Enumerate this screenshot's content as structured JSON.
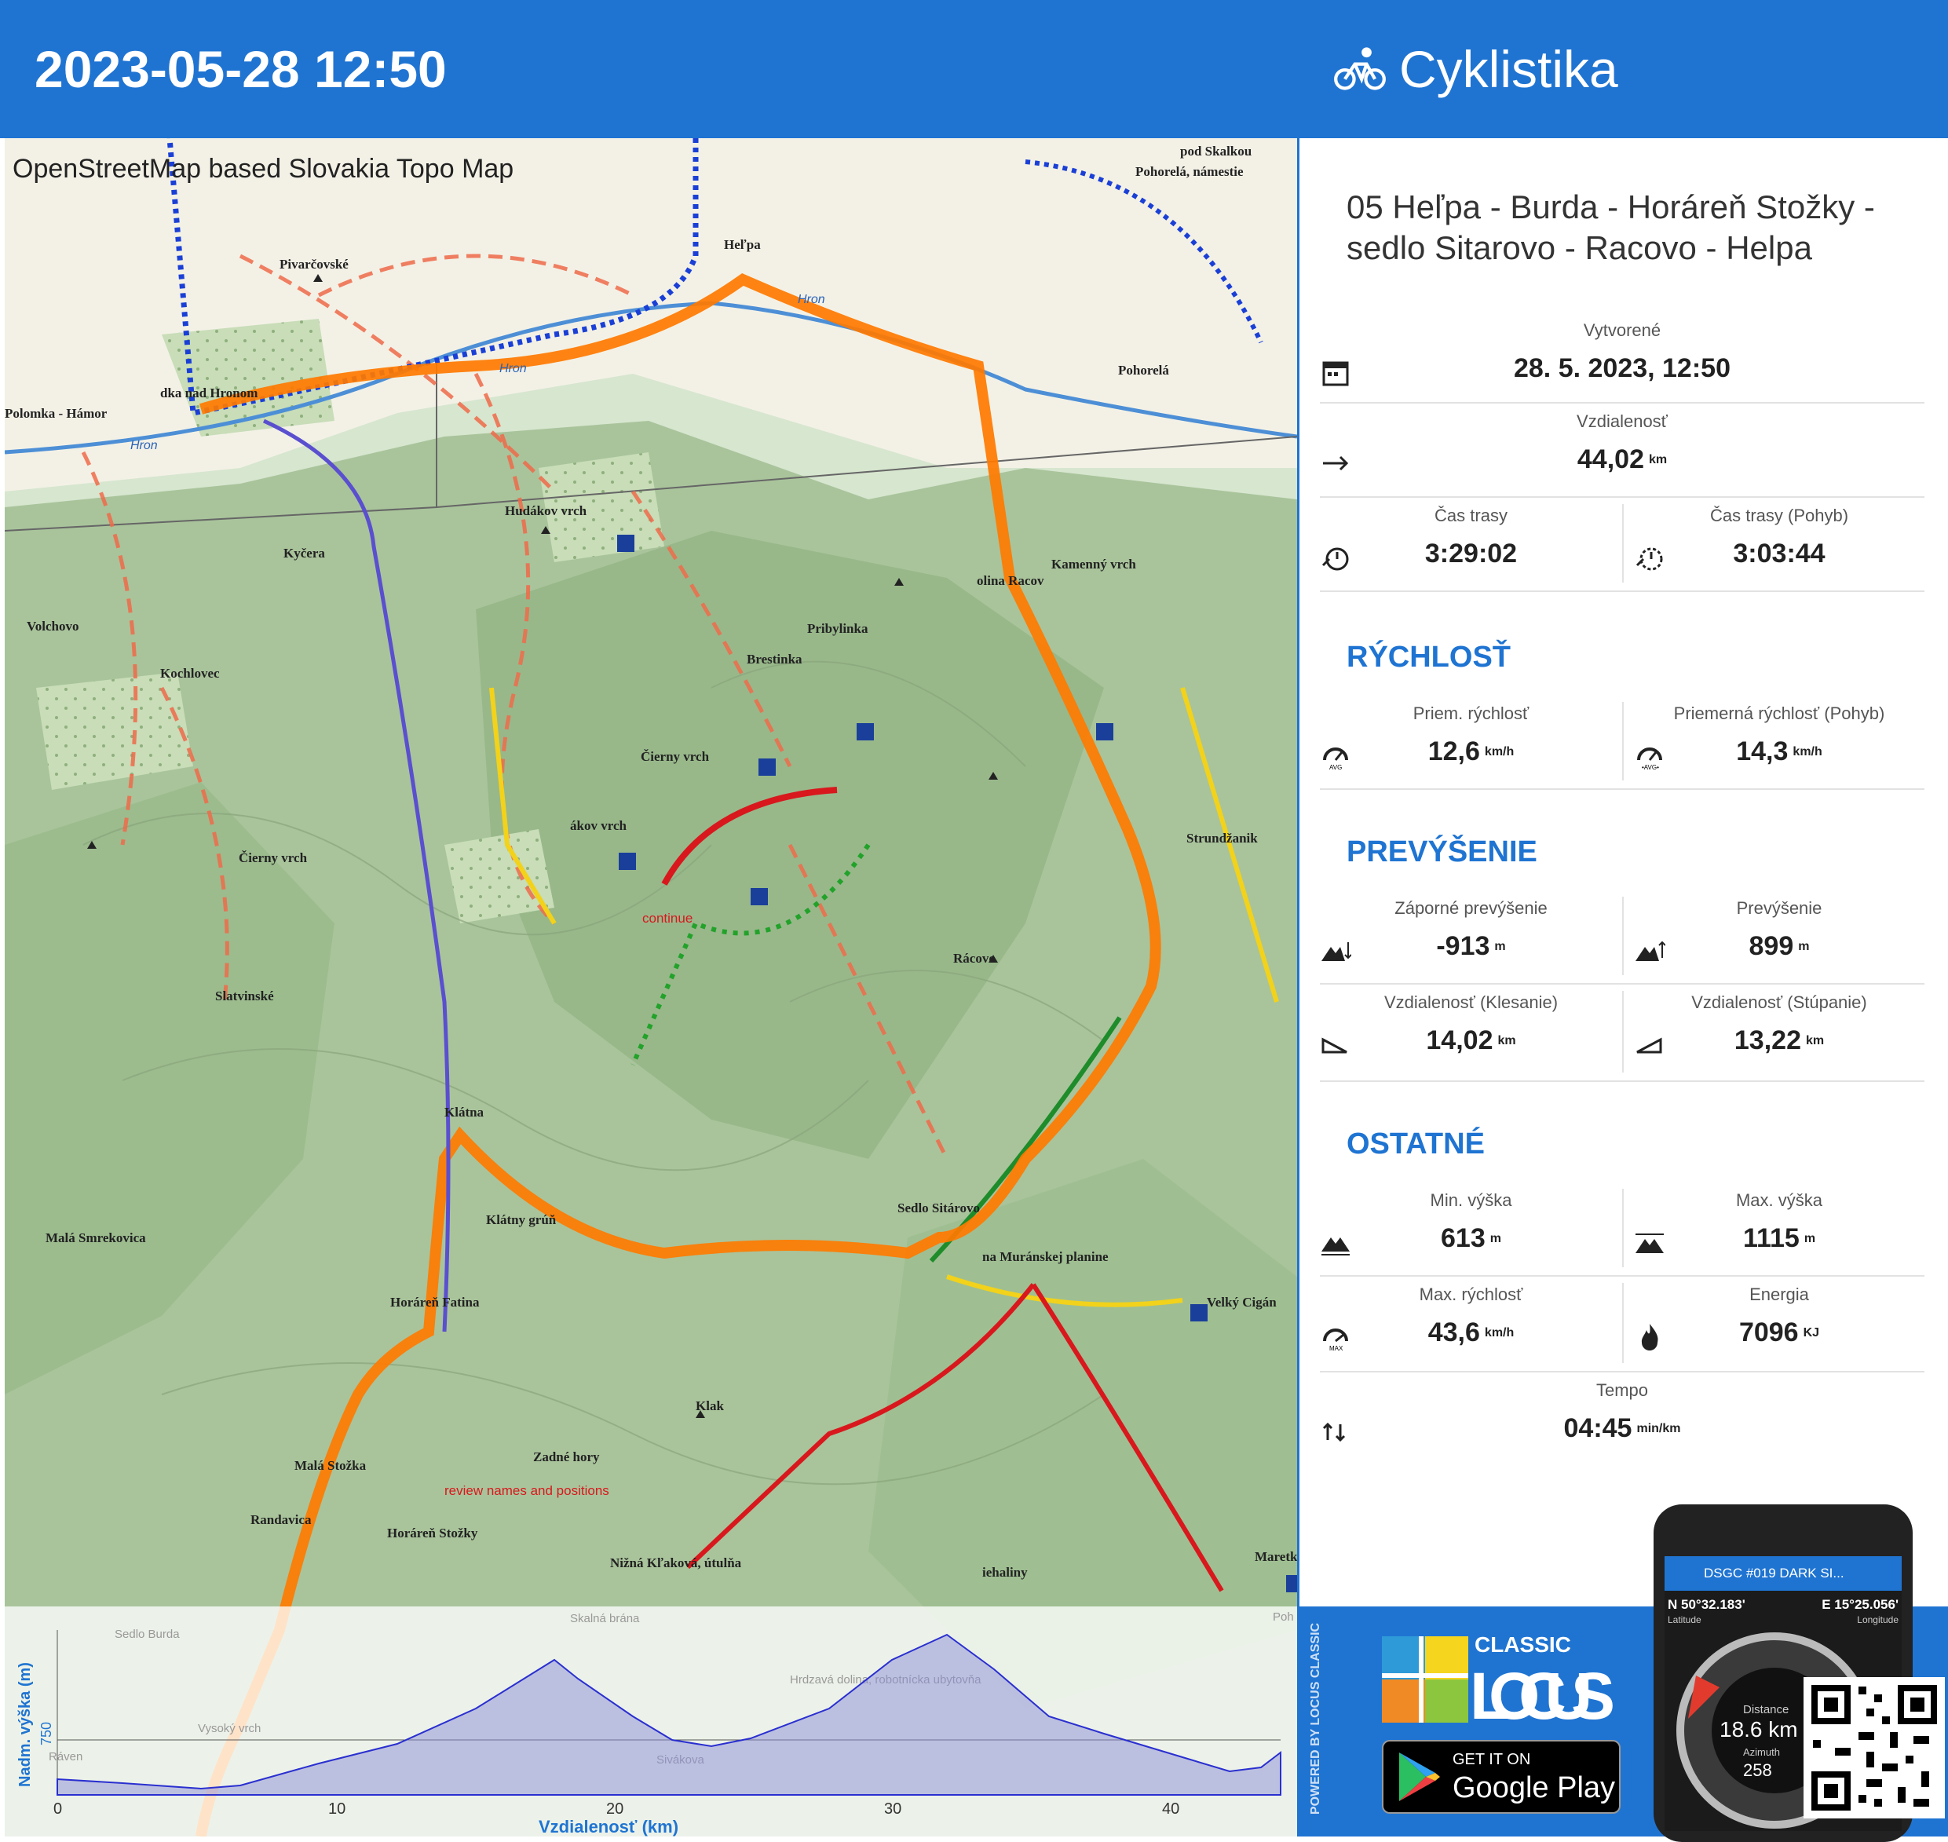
{
  "header": {
    "datetime": "2023-05-28 12:50",
    "activity": "Cyklistika",
    "activity_icon": "bicycle-icon"
  },
  "map": {
    "source_label": "OpenStreetMap based Slovakia Topo Map",
    "places": [
      "Heľpa",
      "Pohorelá, námestie",
      "pod Skalkou",
      "Pohorelá",
      "dka nad Hronom",
      "Polomka - Hámor",
      "Pivarčovské",
      "Hudákov vrch",
      "Kyčera",
      "Volchovo",
      "Kochlovec",
      "Čierny vrch",
      "Slatvinské",
      "Malá Smrekovica",
      "Klátna",
      "Klátny grúň",
      "Horáreň Fatina",
      "Malá Stožka",
      "Randavica",
      "Horáreň Stožky",
      "Nižná Kľaková, útulňa",
      "Sedlo Sitárovo",
      "Rácovo",
      "Kamenný vrch",
      "Strundžanik",
      "Velký Cigán",
      "Maretk",
      "ákov vrch",
      "Brestinka",
      "Pribylinka",
      "Klak",
      "Zadné hory",
      "olina Racov",
      "na Muránskej planine",
      "iehaliny",
      "Hron"
    ],
    "notes": [
      "continue",
      "review names and positions"
    ],
    "route_color": "#ff7a00"
  },
  "profile": {
    "y_label": "Nadm. výška (m)",
    "x_label": "Vzdialenosť (km)",
    "y_tick": "750",
    "x_ticks": [
      "0",
      "10",
      "20",
      "30",
      "40"
    ],
    "bg_places": [
      "Sedlo Burda",
      "Skalná brána",
      "Hrdzavá dolina, robotnícka ubytovňa",
      "Vysoký vrch",
      "Sivákova",
      "Ráven",
      "Poh"
    ]
  },
  "stats": {
    "title": "05 Heľpa - Burda - Horáreň Stožky - sedlo Sitarovo - Racovo - Helpa",
    "created": {
      "label": "Vytvorené",
      "value": "28. 5. 2023, 12:50"
    },
    "distance": {
      "label": "Vzdialenosť",
      "value": "44,02",
      "unit": "km"
    },
    "time_total": {
      "label": "Čas trasy",
      "value": "3:29:02"
    },
    "time_moving": {
      "label": "Čas trasy (Pohyb)",
      "value": "3:03:44"
    },
    "speed_section": "RÝCHLOSŤ",
    "avg_speed": {
      "label": "Priem. rýchlosť",
      "value": "12,6",
      "unit": "km/h"
    },
    "avg_speed_moving": {
      "label": "Priemerná rýchlosť (Pohyb)",
      "value": "14,3",
      "unit": "km/h"
    },
    "elev_section": "PREVÝŠENIE",
    "descent": {
      "label": "Záporné prevýšenie",
      "value": "-913",
      "unit": "m"
    },
    "ascent": {
      "label": "Prevýšenie",
      "value": "899",
      "unit": "m"
    },
    "dist_down": {
      "label": "Vzdialenosť (Klesanie)",
      "value": "14,02",
      "unit": "km"
    },
    "dist_up": {
      "label": "Vzdialenosť (Stúpanie)",
      "value": "13,22",
      "unit": "km"
    },
    "other_section": "OSTATNÉ",
    "min_alt": {
      "label": "Min. výška",
      "value": "613",
      "unit": "m"
    },
    "max_alt": {
      "label": "Max. výška",
      "value": "1115",
      "unit": "m"
    },
    "max_speed": {
      "label": "Max. rýchlosť",
      "value": "43,6",
      "unit": "km/h"
    },
    "energy": {
      "label": "Energia",
      "value": "7096",
      "unit": "KJ"
    },
    "pace": {
      "label": "Tempo",
      "value": "04:45",
      "unit": "min/km"
    }
  },
  "promo": {
    "powered": "POWERED BY LOCUS CLASSIC",
    "brand_top": "CLASSIC",
    "brand": "LOCUS",
    "gp_small": "GET IT ON",
    "gp_big": "Google Play",
    "phone_title": "DSGC #019 DARK SI...",
    "lat": "N 50°32.183'",
    "lat_label": "Latitude",
    "lon": "E 15°25.056'",
    "lon_label": "Longitude",
    "dist_label": "Distance",
    "dist_value": "18.6 km",
    "azim_label": "Azimuth",
    "azim_value": "258"
  }
}
